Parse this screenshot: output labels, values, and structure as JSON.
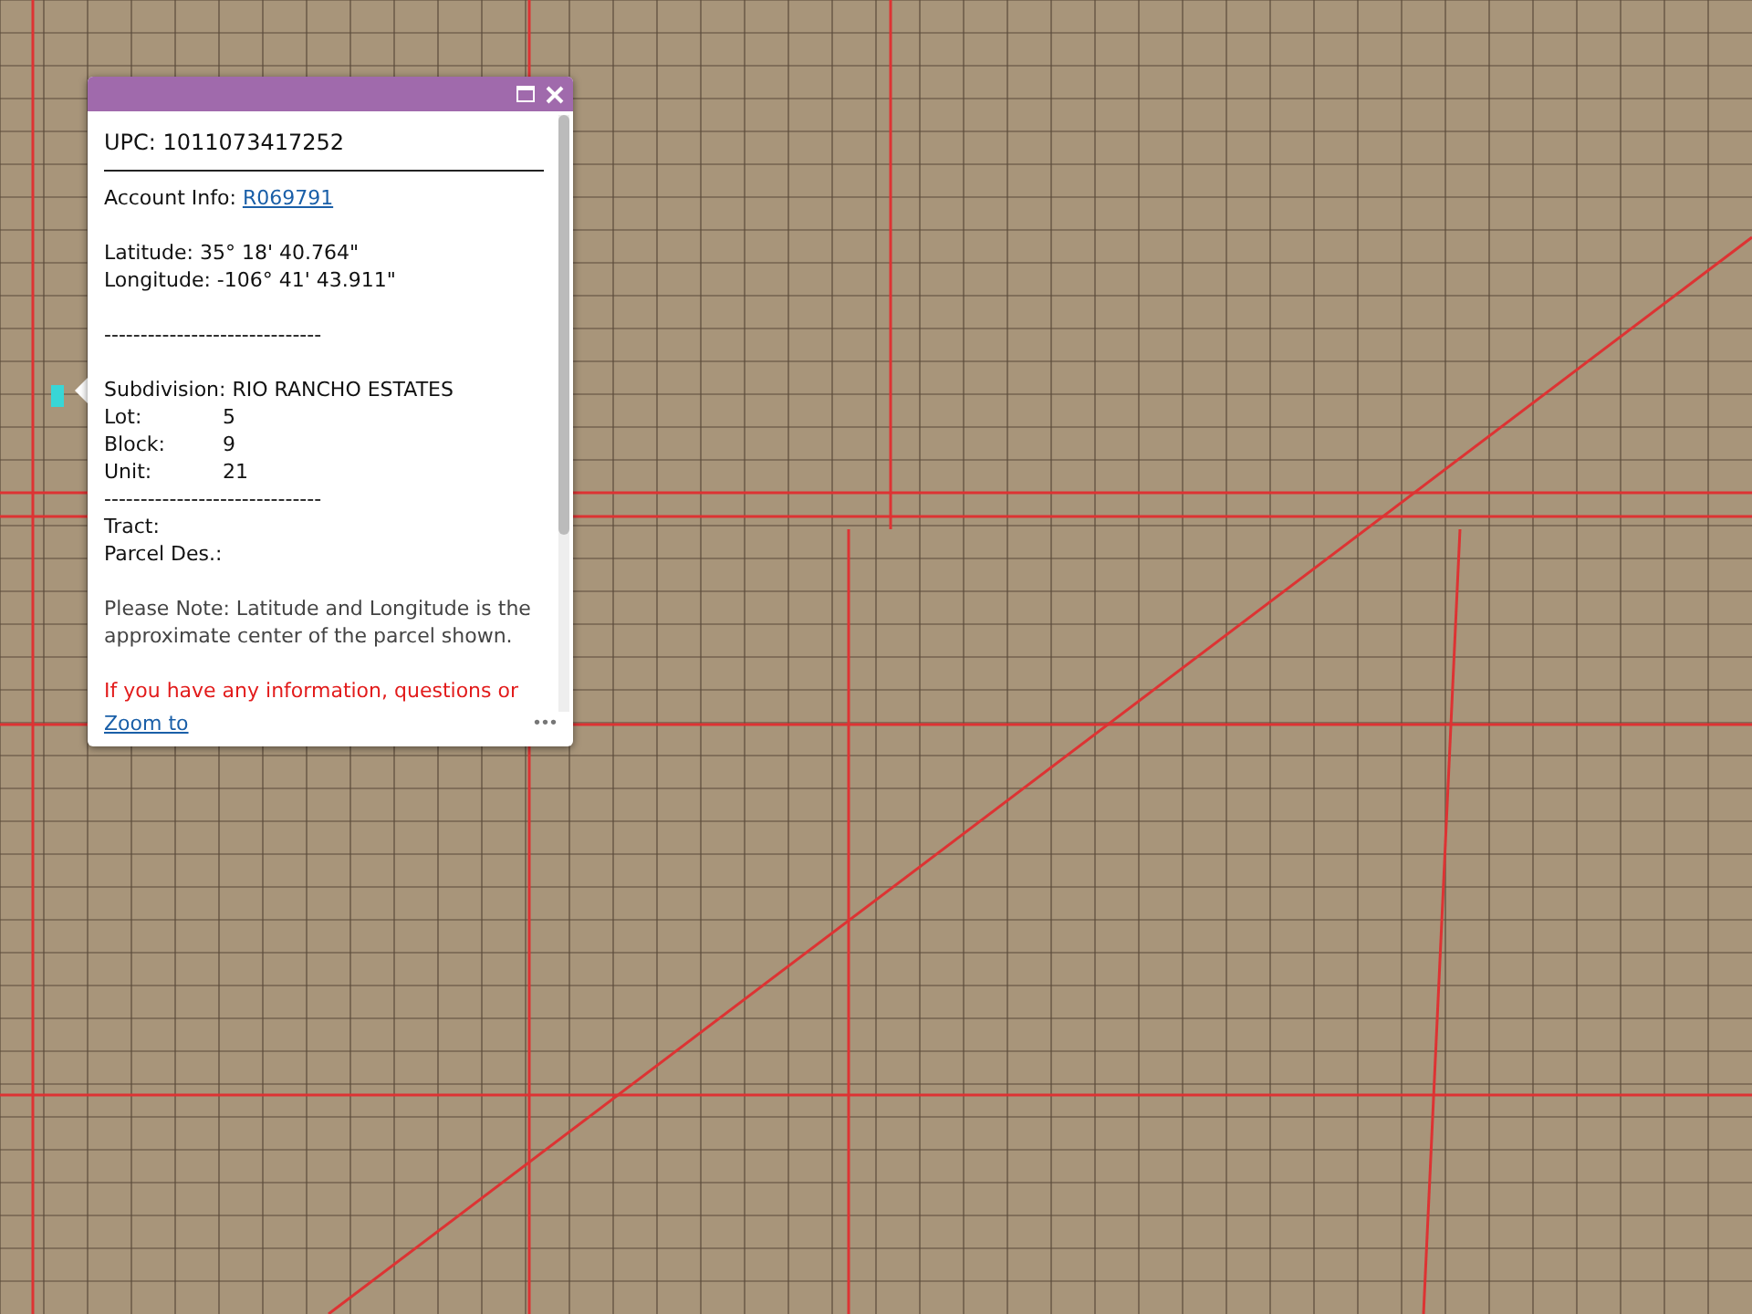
{
  "popup": {
    "title_bar": {
      "maximized": false
    },
    "heading": "UPC: 1011073417252",
    "account": {
      "label": "Account Info:",
      "link": "R069791"
    },
    "coordinates": [
      "Latitude: 35° 18' 40.764\"",
      "Longitude: -106° 41' 43.911\""
    ],
    "separator_1": "------------------------------",
    "details": [
      {
        "label": "Subdivision:",
        "value": "RIO RANCHO ESTATES",
        "kind": "inline"
      },
      {
        "label": "Lot:",
        "value": "5",
        "kind": "tab"
      },
      {
        "label": "Block:",
        "value": "9",
        "kind": "tab"
      },
      {
        "label": "Unit:",
        "value": "21",
        "kind": "tab"
      }
    ],
    "separator_2": "------------------------------",
    "extra": [
      "Tract:",
      "Parcel Des.:"
    ],
    "note": "Please Note: Latitude and Longitude is the approximate center of the parcel shown.",
    "warning": "If you have any information, questions or",
    "zoom_link": "Zoom to",
    "more_menu": "•••"
  }
}
